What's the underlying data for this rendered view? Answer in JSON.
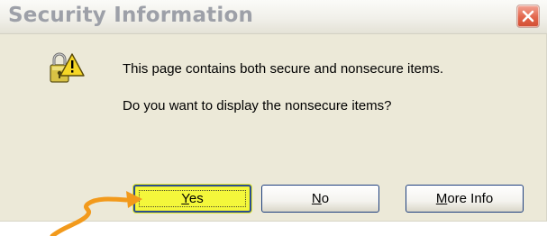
{
  "window": {
    "title": "Security Information"
  },
  "message": {
    "line1": "This page contains both secure and nonsecure items.",
    "line2": "Do you want to display the nonsecure items?"
  },
  "buttons": {
    "yes": {
      "mnemonic": "Y",
      "rest": "es"
    },
    "no": {
      "mnemonic": "N",
      "rest": "o"
    },
    "more_info": {
      "mnemonic": "M",
      "rest": "ore Info"
    }
  },
  "icons": {
    "dialog_icon": "security-warning-icon",
    "close": "close-icon",
    "annotation": "arrow-annotation"
  },
  "colors": {
    "highlight": "#f4f73b",
    "arrow": "#f29a1c",
    "close_button": "#e2664c",
    "title_text": "#9da0a8"
  }
}
